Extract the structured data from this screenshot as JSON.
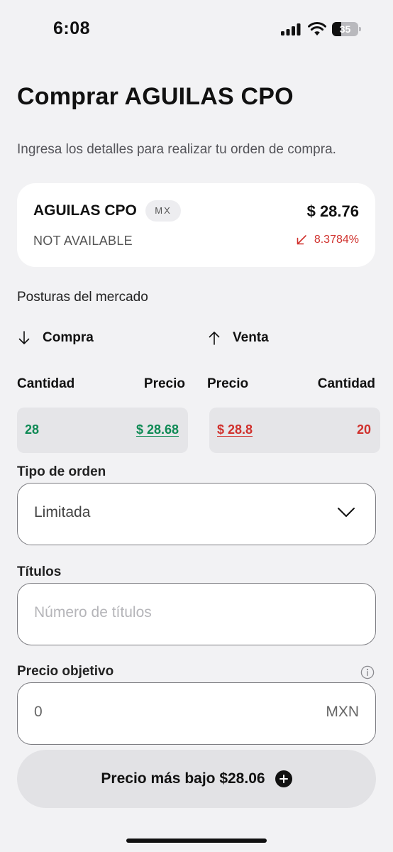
{
  "status_bar": {
    "time": "6:08",
    "battery": "35",
    "battery_level": 0.35
  },
  "header": {
    "title": "Comprar AGUILAS CPO",
    "subtitle": "Ingresa los detalles para realizar tu orden de compra."
  },
  "stock": {
    "name": "AGUILAS CPO",
    "market": "MX",
    "price": "$ 28.76",
    "status": "NOT AVAILABLE",
    "change": "8.3784%",
    "change_direction": "down",
    "change_color": "#d0312d"
  },
  "order_book": {
    "title": "Posturas del mercado",
    "buy": {
      "label": "Compra",
      "qty_header": "Cantidad",
      "price_header": "Precio",
      "qty": "28",
      "price": "$ 28.68",
      "color": "#0f8a55"
    },
    "sell": {
      "label": "Venta",
      "price_header": "Precio",
      "qty_header": "Cantidad",
      "price": "$ 28.8",
      "qty": "20",
      "color": "#d0312d"
    }
  },
  "order_type": {
    "label": "Tipo de orden",
    "value": "Limitada"
  },
  "titles": {
    "label": "Títulos",
    "placeholder": "Número de títulos"
  },
  "target_price": {
    "label": "Precio objetivo",
    "value": "0",
    "currency": "MXN"
  },
  "lowest_price_button": {
    "label": "Precio más bajo $28.06"
  },
  "icons": {
    "signal": "cellular-signal-icon",
    "wifi": "wifi-icon",
    "battery": "battery-icon",
    "change": "arrow-down-left-icon",
    "buy": "arrow-down-icon",
    "sell": "arrow-up-icon",
    "dropdown": "chevron-down-icon",
    "info": "info-icon",
    "add": "plus-circle-icon"
  }
}
